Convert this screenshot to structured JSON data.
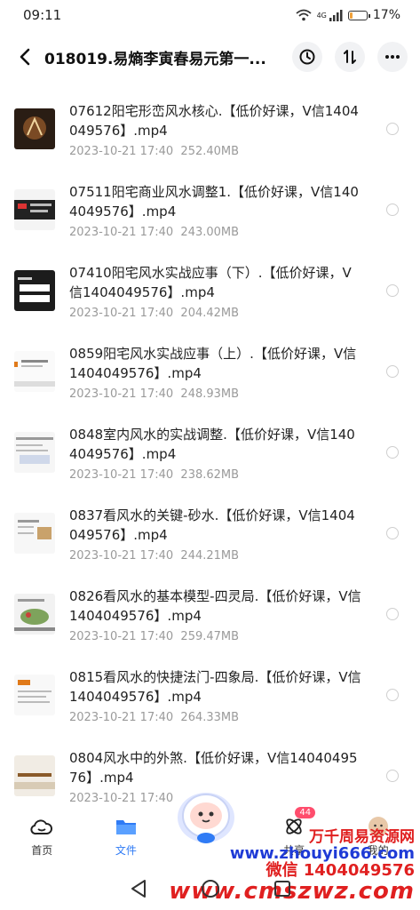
{
  "status": {
    "time": "09:11",
    "battery": "17%",
    "net": "4G"
  },
  "header": {
    "title": "018019.易熵李寅春易元第一..."
  },
  "files": [
    {
      "name": "07612阳宅形峦风水核心.【低价好课，V信1404049576】.mp4",
      "date": "2023-10-21  17:40",
      "size": "252.40MB"
    },
    {
      "name": "07511阳宅商业风水调整1.【低价好课，V信1404049576】.mp4",
      "date": "2023-10-21  17:40",
      "size": "243.00MB"
    },
    {
      "name": "07410阳宅风水实战应事（下）.【低价好课，V信1404049576】.mp4",
      "date": "2023-10-21  17:40",
      "size": "204.42MB"
    },
    {
      "name": "0859阳宅风水实战应事（上）.【低价好课，V信1404049576】.mp4",
      "date": "2023-10-21  17:40",
      "size": "248.93MB"
    },
    {
      "name": "0848室内风水的实战调整.【低价好课，V信1404049576】.mp4",
      "date": "2023-10-21  17:40",
      "size": "238.62MB"
    },
    {
      "name": "0837看风水的关键-砂水.【低价好课，V信1404049576】.mp4",
      "date": "2023-10-21  17:40",
      "size": "244.21MB"
    },
    {
      "name": "0826看风水的基本模型-四灵局.【低价好课，V信1404049576】.mp4",
      "date": "2023-10-21  17:40",
      "size": "259.47MB"
    },
    {
      "name": "0815看风水的快捷法门-四象局.【低价好课，V信1404049576】.mp4",
      "date": "2023-10-21  17:40",
      "size": "264.33MB"
    },
    {
      "name": "0804风水中的外煞.【低价好课，V信1404049576】.mp4",
      "date": "2023-10-21  17:40",
      "size": ""
    }
  ],
  "nav": {
    "home": "首页",
    "files": "文件",
    "share": "共享",
    "mine": "我的",
    "share_badge": "44"
  },
  "watermark": {
    "line1": "万千周易资源网",
    "line2": "www.zhouyi666.com",
    "line3": "微信 1404049576",
    "line4": "www.cmszwz.com"
  },
  "colors": {
    "accent": "#2f7bf5",
    "watermark_red": "#e02020",
    "watermark_blue": "#1f3bd6"
  }
}
